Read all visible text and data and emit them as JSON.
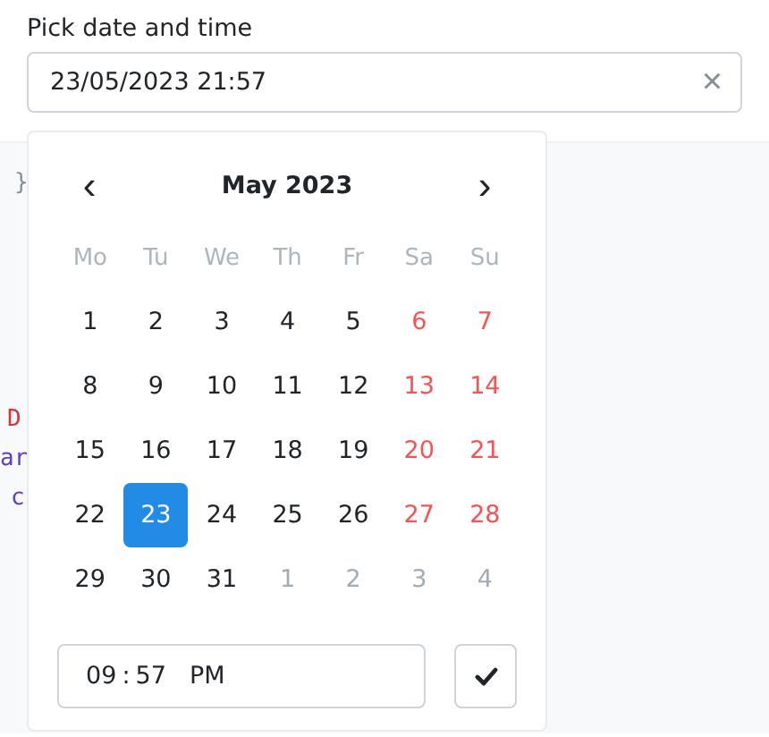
{
  "label": "Pick date and time",
  "input": {
    "value": "23/05/2023 21:57",
    "clear": "×"
  },
  "code_fragments": [
    {
      "text": "}",
      "color": "#868e96"
    },
    {
      "text": "D",
      "color": "#e03131"
    },
    {
      "text": "ar",
      "color": "#5f3dc4"
    },
    {
      "text": "c",
      "color": "#5f3dc4"
    }
  ],
  "calendar": {
    "prev": "‹",
    "title": "May 2023",
    "next": "›",
    "weekdays": [
      "Mo",
      "Tu",
      "We",
      "Th",
      "Fr",
      "Sa",
      "Su"
    ],
    "days": [
      {
        "label": "1",
        "outside": false,
        "weekend": false,
        "selected": false
      },
      {
        "label": "2",
        "outside": false,
        "weekend": false,
        "selected": false
      },
      {
        "label": "3",
        "outside": false,
        "weekend": false,
        "selected": false
      },
      {
        "label": "4",
        "outside": false,
        "weekend": false,
        "selected": false
      },
      {
        "label": "5",
        "outside": false,
        "weekend": false,
        "selected": false
      },
      {
        "label": "6",
        "outside": false,
        "weekend": true,
        "selected": false
      },
      {
        "label": "7",
        "outside": false,
        "weekend": true,
        "selected": false
      },
      {
        "label": "8",
        "outside": false,
        "weekend": false,
        "selected": false
      },
      {
        "label": "9",
        "outside": false,
        "weekend": false,
        "selected": false
      },
      {
        "label": "10",
        "outside": false,
        "weekend": false,
        "selected": false
      },
      {
        "label": "11",
        "outside": false,
        "weekend": false,
        "selected": false
      },
      {
        "label": "12",
        "outside": false,
        "weekend": false,
        "selected": false
      },
      {
        "label": "13",
        "outside": false,
        "weekend": true,
        "selected": false
      },
      {
        "label": "14",
        "outside": false,
        "weekend": true,
        "selected": false
      },
      {
        "label": "15",
        "outside": false,
        "weekend": false,
        "selected": false
      },
      {
        "label": "16",
        "outside": false,
        "weekend": false,
        "selected": false
      },
      {
        "label": "17",
        "outside": false,
        "weekend": false,
        "selected": false
      },
      {
        "label": "18",
        "outside": false,
        "weekend": false,
        "selected": false
      },
      {
        "label": "19",
        "outside": false,
        "weekend": false,
        "selected": false
      },
      {
        "label": "20",
        "outside": false,
        "weekend": true,
        "selected": false
      },
      {
        "label": "21",
        "outside": false,
        "weekend": true,
        "selected": false
      },
      {
        "label": "22",
        "outside": false,
        "weekend": false,
        "selected": false
      },
      {
        "label": "23",
        "outside": false,
        "weekend": false,
        "selected": true
      },
      {
        "label": "24",
        "outside": false,
        "weekend": false,
        "selected": false
      },
      {
        "label": "25",
        "outside": false,
        "weekend": false,
        "selected": false
      },
      {
        "label": "26",
        "outside": false,
        "weekend": false,
        "selected": false
      },
      {
        "label": "27",
        "outside": false,
        "weekend": true,
        "selected": false
      },
      {
        "label": "28",
        "outside": false,
        "weekend": true,
        "selected": false
      },
      {
        "label": "29",
        "outside": false,
        "weekend": false,
        "selected": false
      },
      {
        "label": "30",
        "outside": false,
        "weekend": false,
        "selected": false
      },
      {
        "label": "31",
        "outside": false,
        "weekend": false,
        "selected": false
      },
      {
        "label": "1",
        "outside": true,
        "weekend": false,
        "selected": false
      },
      {
        "label": "2",
        "outside": true,
        "weekend": false,
        "selected": false
      },
      {
        "label": "3",
        "outside": true,
        "weekend": true,
        "selected": false
      },
      {
        "label": "4",
        "outside": true,
        "weekend": true,
        "selected": false
      }
    ]
  },
  "time": {
    "hours": "09",
    "separator": ":",
    "minutes": "57",
    "period": "PM"
  }
}
